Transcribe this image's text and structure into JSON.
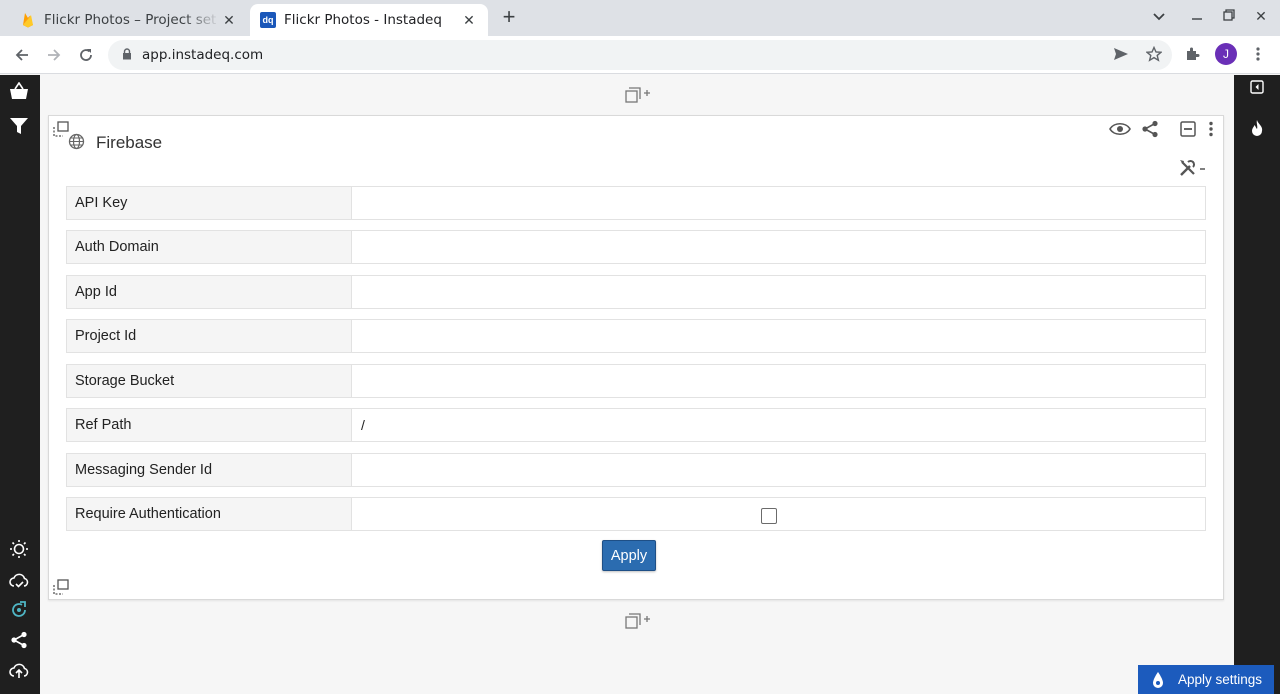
{
  "browser": {
    "tabs": [
      {
        "title": "Flickr Photos – Project set",
        "icon": "firebase-icon"
      },
      {
        "title": "Flickr Photos - Instadeq",
        "icon": "dq-icon",
        "icon_text": "dq"
      }
    ],
    "url": "app.instadeq.com",
    "profile_initial": "J"
  },
  "panel": {
    "title": "Firebase",
    "fields": [
      {
        "label": "API Key",
        "value": ""
      },
      {
        "label": "Auth Domain",
        "value": ""
      },
      {
        "label": "App Id",
        "value": ""
      },
      {
        "label": "Project Id",
        "value": ""
      },
      {
        "label": "Storage Bucket",
        "value": ""
      },
      {
        "label": "Ref Path",
        "value": "/"
      },
      {
        "label": "Messaging Sender Id",
        "value": ""
      }
    ],
    "require_auth_label": "Require Authentication",
    "require_auth_checked": false,
    "apply_label": "Apply"
  },
  "footer": {
    "apply_settings_label": "Apply settings"
  },
  "colors": {
    "accent": "#2b6cb0",
    "sidebar": "#1f1f1f",
    "apply_settings_bg": "#1c5bbd"
  }
}
